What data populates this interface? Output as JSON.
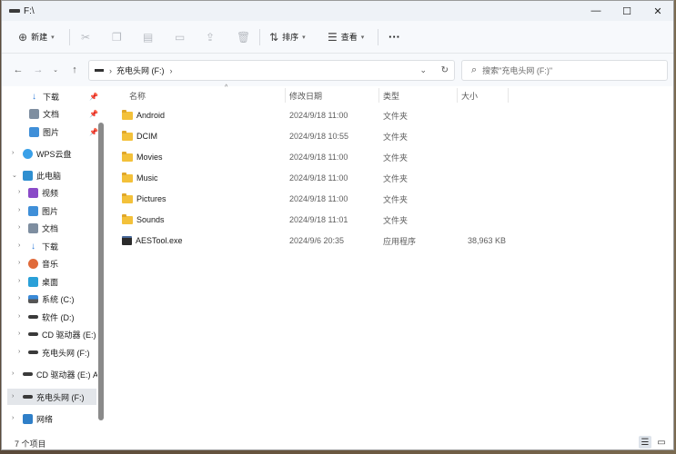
{
  "window": {
    "title": "F:\\",
    "minimize": "—",
    "maximize": "☐",
    "close": "✕"
  },
  "toolbar": {
    "new_label": "新建",
    "sort_label": "排序",
    "view_label": "查看",
    "more_label": "···"
  },
  "nav": {
    "address_text": "充电头网 (F:)",
    "search_placeholder": "搜索\"充电头网 (F:)\""
  },
  "sidebar": {
    "items": [
      {
        "label": "下载",
        "icon": "download-icon",
        "pinned": true
      },
      {
        "label": "文档",
        "icon": "document-icon",
        "pinned": true
      },
      {
        "label": "图片",
        "icon": "picture-icon",
        "pinned": true
      },
      {
        "label": "WPS云盘",
        "icon": "cloud-icon",
        "pinned": false
      },
      {
        "label": "此电脑",
        "icon": "computer-icon",
        "pinned": false
      },
      {
        "label": "视频",
        "icon": "video-icon",
        "pinned": false
      },
      {
        "label": "图片",
        "icon": "picture-icon",
        "pinned": false
      },
      {
        "label": "文档",
        "icon": "document-icon",
        "pinned": false
      },
      {
        "label": "下载",
        "icon": "download-icon",
        "pinned": false
      },
      {
        "label": "音乐",
        "icon": "music-icon",
        "pinned": false
      },
      {
        "label": "桌面",
        "icon": "desktop-icon",
        "pinned": false
      },
      {
        "label": "系统 (C:)",
        "icon": "drive-icon",
        "pinned": false
      },
      {
        "label": "软件 (D:)",
        "icon": "drive-icon",
        "pinned": false
      },
      {
        "label": "CD 驱动器 (E:) A",
        "icon": "drive-icon",
        "pinned": false
      },
      {
        "label": "充电头网 (F:)",
        "icon": "drive-icon",
        "pinned": false
      },
      {
        "label": "CD 驱动器 (E:) AE",
        "icon": "drive-icon",
        "pinned": false
      },
      {
        "label": "充电头网 (F:)",
        "icon": "drive-icon",
        "pinned": false
      },
      {
        "label": "网络",
        "icon": "network-icon",
        "pinned": false
      }
    ]
  },
  "columns": {
    "name": "名称",
    "modified": "修改日期",
    "type": "类型",
    "size": "大小"
  },
  "files": [
    {
      "name": "Android",
      "modified": "2024/9/18 11:00",
      "type": "文件夹",
      "size": "",
      "kind": "folder"
    },
    {
      "name": "DCIM",
      "modified": "2024/9/18 10:55",
      "type": "文件夹",
      "size": "",
      "kind": "folder"
    },
    {
      "name": "Movies",
      "modified": "2024/9/18 11:00",
      "type": "文件夹",
      "size": "",
      "kind": "folder"
    },
    {
      "name": "Music",
      "modified": "2024/9/18 11:00",
      "type": "文件夹",
      "size": "",
      "kind": "folder"
    },
    {
      "name": "Pictures",
      "modified": "2024/9/18 11:00",
      "type": "文件夹",
      "size": "",
      "kind": "folder"
    },
    {
      "name": "Sounds",
      "modified": "2024/9/18 11:01",
      "type": "文件夹",
      "size": "",
      "kind": "folder"
    },
    {
      "name": "AESTool.exe",
      "modified": "2024/9/6 20:35",
      "type": "应用程序",
      "size": "38,963 KB",
      "kind": "exe"
    }
  ],
  "status": {
    "count_text": "7 个项目"
  },
  "colors": {
    "folder": "#f3c13a",
    "accent": "#0067c0",
    "selected_bg": "#e3e6ea"
  }
}
